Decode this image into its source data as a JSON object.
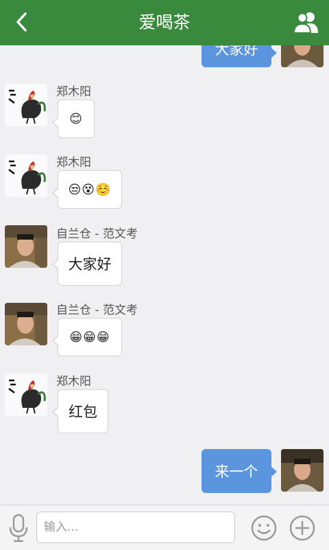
{
  "header": {
    "title": "爱喝茶"
  },
  "messages": [
    {
      "side": "right",
      "text": "大家好"
    },
    {
      "side": "left",
      "sender": "郑木阳",
      "text": "😊"
    },
    {
      "side": "left",
      "sender": "郑木阳",
      "text": "😒😵☺️"
    },
    {
      "side": "left",
      "sender": "自兰仓 - 范文考",
      "text": "大家好"
    },
    {
      "side": "left",
      "sender": "自兰仓 - 范文考",
      "text": "😁😁😁"
    },
    {
      "side": "left",
      "sender": "郑木阳",
      "text": "红包"
    },
    {
      "side": "right",
      "text": "来一个"
    }
  ],
  "input": {
    "placeholder": "输入..."
  },
  "colors": {
    "header": "#3a8a3e",
    "outgoing_bubble": "#5b95de",
    "background": "#f0f0f3"
  },
  "icons": [
    "back-arrow-icon",
    "group-members-icon",
    "microphone-icon",
    "emoji-smile-icon",
    "plus-circle-icon"
  ]
}
